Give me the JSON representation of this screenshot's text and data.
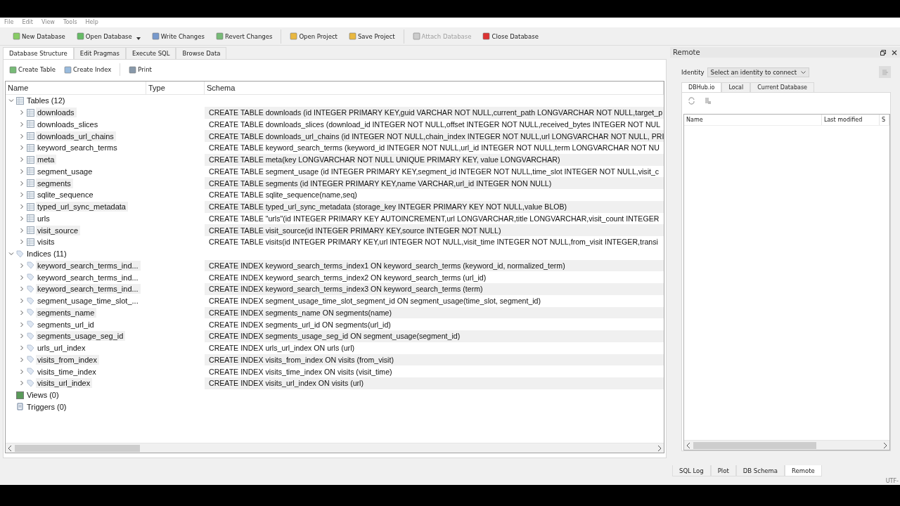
{
  "menu": [
    "File",
    "Edit",
    "View",
    "Tools",
    "Help"
  ],
  "toolbar": [
    [
      {
        "label": "New Database",
        "dropdown": false,
        "disabled": false
      },
      {
        "label": "Open Database",
        "dropdown": true,
        "disabled": false
      },
      {
        "label": "Write Changes",
        "dropdown": false,
        "disabled": false
      },
      {
        "label": "Revert Changes",
        "dropdown": false,
        "disabled": false
      }
    ],
    [
      {
        "label": "Open Project",
        "dropdown": false,
        "disabled": false
      },
      {
        "label": "Save Project",
        "dropdown": false,
        "disabled": false
      }
    ],
    [
      {
        "label": "Attach Database",
        "dropdown": false,
        "disabled": true
      },
      {
        "label": "Close Database",
        "dropdown": false,
        "disabled": false
      }
    ]
  ],
  "tabs": [
    {
      "label": "Database Structure",
      "selected": true
    },
    {
      "label": "Edit Pragmas",
      "selected": false
    },
    {
      "label": "Execute SQL",
      "selected": false
    },
    {
      "label": "Browse Data",
      "selected": false
    }
  ],
  "structure_actions": [
    {
      "label": "Create Table"
    },
    {
      "label": "Create Index"
    },
    {
      "label": "Print"
    }
  ],
  "tree": {
    "columns": [
      "Name",
      "Type",
      "Schema"
    ],
    "items": [
      {
        "label": "Tables (12)",
        "kind": "tables",
        "expanded": true,
        "children": [
          {
            "label": "downloads",
            "expanded": false,
            "schema": "CREATE TABLE downloads (id INTEGER PRIMARY KEY,guid VARCHAR NOT NULL,current_path LONGVARCHAR NOT NULL,target_p"
          },
          {
            "label": "downloads_slices",
            "expanded": false,
            "schema": "CREATE TABLE downloads_slices (download_id INTEGER NOT NULL,offset INTEGER NOT NULL,received_bytes INTEGER NOT NUL"
          },
          {
            "label": "downloads_url_chains",
            "expanded": false,
            "schema": "CREATE TABLE downloads_url_chains (id INTEGER NOT NULL,chain_index INTEGER NOT NULL,url LONGVARCHAR NOT NULL, PRI"
          },
          {
            "label": "keyword_search_terms",
            "expanded": false,
            "schema": "CREATE TABLE keyword_search_terms (keyword_id INTEGER NOT NULL,url_id INTEGER NOT NULL,term LONGVARCHAR NOT NU"
          },
          {
            "label": "meta",
            "expanded": false,
            "schema": "CREATE TABLE meta(key LONGVARCHAR NOT NULL UNIQUE PRIMARY KEY, value LONGVARCHAR)"
          },
          {
            "label": "segment_usage",
            "expanded": false,
            "schema": "CREATE TABLE segment_usage (id INTEGER PRIMARY KEY,segment_id INTEGER NOT NULL,time_slot INTEGER NOT NULL,visit_c"
          },
          {
            "label": "segments",
            "expanded": false,
            "schema": "CREATE TABLE segments (id INTEGER PRIMARY KEY,name VARCHAR,url_id INTEGER NON NULL)"
          },
          {
            "label": "sqlite_sequence",
            "expanded": false,
            "schema": "CREATE TABLE sqlite_sequence(name,seq)"
          },
          {
            "label": "typed_url_sync_metadata",
            "expanded": false,
            "schema": "CREATE TABLE typed_url_sync_metadata (storage_key INTEGER PRIMARY KEY NOT NULL,value BLOB)"
          },
          {
            "label": "urls",
            "expanded": false,
            "schema": "CREATE TABLE \"urls\"(id INTEGER PRIMARY KEY AUTOINCREMENT,url LONGVARCHAR,title LONGVARCHAR,visit_count INTEGER"
          },
          {
            "label": "visit_source",
            "expanded": false,
            "schema": "CREATE TABLE visit_source(id INTEGER PRIMARY KEY,source INTEGER NOT NULL)"
          },
          {
            "label": "visits",
            "expanded": false,
            "schema": "CREATE TABLE visits(id INTEGER PRIMARY KEY,url INTEGER NOT NULL,visit_time INTEGER NOT NULL,from_visit INTEGER,transi"
          }
        ]
      },
      {
        "label": "Indices (11)",
        "kind": "indices",
        "expanded": true,
        "children": [
          {
            "label": "keyword_search_terms_ind...",
            "expanded": false,
            "schema": "CREATE INDEX keyword_search_terms_index1 ON keyword_search_terms (keyword_id, normalized_term)"
          },
          {
            "label": "keyword_search_terms_ind...",
            "expanded": false,
            "schema": "CREATE INDEX keyword_search_terms_index2 ON keyword_search_terms (url_id)"
          },
          {
            "label": "keyword_search_terms_ind...",
            "expanded": false,
            "schema": "CREATE INDEX keyword_search_terms_index3 ON keyword_search_terms (term)"
          },
          {
            "label": "segment_usage_time_slot_...",
            "expanded": false,
            "schema": "CREATE INDEX segment_usage_time_slot_segment_id ON segment_usage(time_slot, segment_id)"
          },
          {
            "label": "segments_name",
            "expanded": false,
            "schema": "CREATE INDEX segments_name ON segments(name)"
          },
          {
            "label": "segments_url_id",
            "expanded": false,
            "schema": "CREATE INDEX segments_url_id ON segments(url_id)"
          },
          {
            "label": "segments_usage_seg_id",
            "expanded": false,
            "schema": "CREATE INDEX segments_usage_seg_id ON segment_usage(segment_id)"
          },
          {
            "label": "urls_url_index",
            "expanded": false,
            "schema": "CREATE INDEX urls_url_index ON urls (url)"
          },
          {
            "label": "visits_from_index",
            "expanded": false,
            "schema": "CREATE INDEX visits_from_index ON visits (from_visit)"
          },
          {
            "label": "visits_time_index",
            "expanded": false,
            "schema": "CREATE INDEX visits_time_index ON visits (visit_time)"
          },
          {
            "label": "visits_url_index",
            "expanded": false,
            "schema": "CREATE INDEX visits_url_index ON visits (url)"
          }
        ]
      },
      {
        "label": "Views (0)",
        "kind": "views"
      },
      {
        "label": "Triggers (0)",
        "kind": "triggers"
      }
    ]
  },
  "remote": {
    "title": "Remote",
    "identity_label": "Identity",
    "identity_select": "Select an identity to connect",
    "tabs": [
      {
        "label": "DBHub.io",
        "selected": true
      },
      {
        "label": "Local",
        "selected": false
      },
      {
        "label": "Current Database",
        "selected": false
      }
    ],
    "list_columns": [
      "Name",
      "Last modified",
      "S"
    ]
  },
  "bottom_tabs": [
    {
      "label": "SQL Log",
      "selected": false
    },
    {
      "label": "Plot",
      "selected": false
    },
    {
      "label": "DB Schema",
      "selected": false
    },
    {
      "label": "Remote",
      "selected": true
    }
  ],
  "status_bar": {
    "encoding": "UTF-"
  }
}
